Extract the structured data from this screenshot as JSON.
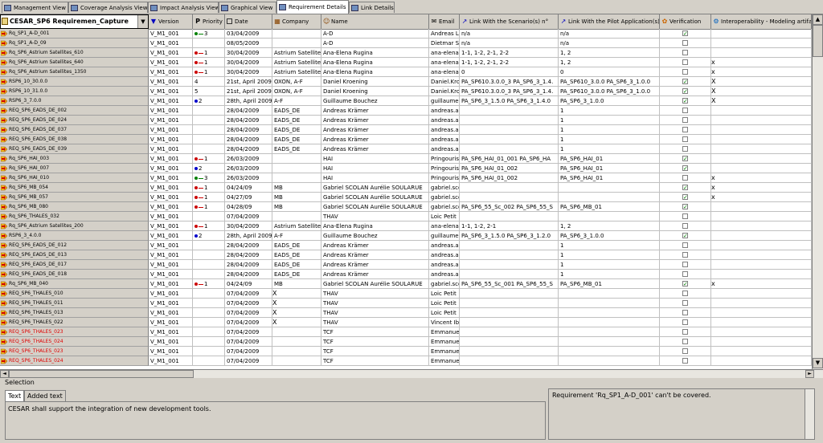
{
  "tabs": [
    {
      "label": "Management View",
      "active": false
    },
    {
      "label": "Coverage Analysis View",
      "active": false
    },
    {
      "label": "Impact Analysis View",
      "active": false
    },
    {
      "label": "Graphical View",
      "active": false
    },
    {
      "label": "Requirement Details",
      "active": true
    },
    {
      "label": "Link Details",
      "active": false
    }
  ],
  "selector": {
    "value": "CESAR_SP6   Requiremen_Capture"
  },
  "columns": [
    "Version",
    "Priority",
    "Date",
    "Company",
    "Name",
    "Email",
    "Link With the Scenario(s) n°",
    "Link With the Pilot Application(s) n°",
    "Verification",
    "Interoperability - Modeling artifact"
  ],
  "rows": [
    {
      "id": "Rq_SP1_A-D_001",
      "red": false,
      "version": "V_M1_001",
      "pcolor": "#008000",
      "pnum": "3",
      "date": "03/04/2009",
      "company": "",
      "name": "A-D",
      "email": "Andreas Len",
      "scen": "n/a",
      "pilot": "n/a",
      "ver": true,
      "interop": ""
    },
    {
      "id": "Rq_SP1_A-D_09",
      "red": false,
      "version": "V_M1_001",
      "pcolor": "",
      "pnum": "",
      "date": "08/05/2009",
      "company": "",
      "name": "A-D",
      "email": "Dietmar Sa",
      "scen": "n/a",
      "pilot": "n/a",
      "ver": false,
      "interop": ""
    },
    {
      "id": "Rq_SP6_Astrium Satellites_610",
      "red": false,
      "version": "V_M1_001",
      "pcolor": "#cc0000",
      "pnum": "1",
      "date": "30/04/2009",
      "company": "Astrium Satellites",
      "name": "Ana-Elena Rugina",
      "email": "ana-elena.r",
      "scen": "1-1, 1-2, 2-1, 2-2",
      "pilot": "1, 2",
      "ver": false,
      "interop": ""
    },
    {
      "id": "Rq_SP6_Astrium Satellites_640",
      "red": false,
      "version": "V_M1_001",
      "pcolor": "#cc0000",
      "pnum": "1",
      "date": "30/04/2009",
      "company": "Astrium Satellites",
      "name": "Ana-Elena Rugina",
      "email": "ana-elena.r",
      "scen": "1-1, 1-2, 2-1, 2-2",
      "pilot": "1, 2",
      "ver": false,
      "interop": "x"
    },
    {
      "id": "Rq_SP6_Astrium Satellites_1350",
      "red": false,
      "version": "V_M1_001",
      "pcolor": "#cc0000",
      "pnum": "1",
      "date": "30/04/2009",
      "company": "Astrium Satellites",
      "name": "Ana-Elena Rugina",
      "email": "ana-elena.r",
      "scen": "0",
      "pilot": "0",
      "ver": false,
      "interop": "x"
    },
    {
      "id": "RSP6_10_30.0.0",
      "red": false,
      "version": "V_M1_001",
      "pcolor": "",
      "pnum": "4",
      "date": "21st, April 2009",
      "company": "OXON, A-F",
      "name": "Daniel Kroening",
      "email": "Daniel.Kroe",
      "scen": "PA_SP610.3.0.0_3 PA_SP6_3_1.4.",
      "pilot": "PA_SP610_3.0.0 PA_SP6_3_1.0.0",
      "ver": true,
      "interop": "X"
    },
    {
      "id": "RSP6_10_31.0.0",
      "red": false,
      "version": "V_M1_001",
      "pcolor": "",
      "pnum": "5",
      "date": "21st, April 2009",
      "company": "OXON, A-F",
      "name": "Daniel Kroening",
      "email": "Daniel.Kroe",
      "scen": "PA_SP610.3.0.0_3 PA_SP6_3_1.4.",
      "pilot": "PA_SP610_3.0.0 PA_SP6_3_1.0.0",
      "ver": true,
      "interop": "X"
    },
    {
      "id": "RSP6_3_7.0.0",
      "red": false,
      "version": "V_M1_001",
      "pcolor": "#0000cc",
      "pnum": "2",
      "date": "28th, April 2009",
      "company": "A-F",
      "name": "Guillaume Bouchez",
      "email": "guillaume.b",
      "scen": "PA_SP6_3_1.5.0 PA_SP6_3_1.4.0",
      "pilot": "PA_SP6_3_1.0.0",
      "ver": true,
      "interop": "X"
    },
    {
      "id": "REQ_SP6_EADS_DE_002",
      "red": false,
      "version": "V_M1_001",
      "pcolor": "",
      "pnum": "",
      "date": "28/04/2009",
      "company": "EADS_DE",
      "name": "Andreas Krämer",
      "email": "andreas.a.k",
      "scen": "",
      "pilot": "1",
      "ver": false,
      "interop": ""
    },
    {
      "id": "REQ_SP6_EADS_DE_024",
      "red": false,
      "version": "V_M1_001",
      "pcolor": "",
      "pnum": "",
      "date": "28/04/2009",
      "company": "EADS_DE",
      "name": "Andreas Krämer",
      "email": "andreas.a.k",
      "scen": "",
      "pilot": "1",
      "ver": false,
      "interop": ""
    },
    {
      "id": "REQ_SP6_EADS_DE_037",
      "red": false,
      "version": "V_M1_001",
      "pcolor": "",
      "pnum": "",
      "date": "28/04/2009",
      "company": "EADS_DE",
      "name": "Andreas Krämer",
      "email": "andreas.a.k",
      "scen": "",
      "pilot": "1",
      "ver": false,
      "interop": ""
    },
    {
      "id": "REQ_SP6_EADS_DE_038",
      "red": false,
      "version": "V_M1_001",
      "pcolor": "",
      "pnum": "",
      "date": "28/04/2009",
      "company": "EADS_DE",
      "name": "Andreas Krämer",
      "email": "andreas.a.k",
      "scen": "",
      "pilot": "1",
      "ver": false,
      "interop": ""
    },
    {
      "id": "REQ_SP6_EADS_DE_039",
      "red": false,
      "version": "V_M1_001",
      "pcolor": "",
      "pnum": "",
      "date": "28/04/2009",
      "company": "EADS_DE",
      "name": "Andreas Krämer",
      "email": "andreas.a.k",
      "scen": "",
      "pilot": "1",
      "ver": false,
      "interop": ""
    },
    {
      "id": "Rq_SP6_HAI_003",
      "red": false,
      "version": "V_M1_001",
      "pcolor": "#cc0000",
      "pnum": "1",
      "date": "26/03/2009",
      "company": "",
      "name": "HAI",
      "email": "Pringouris",
      "scen": "PA_SP6_HAI_01_001 PA_SP6_HA",
      "pilot": "PA_SP6_HAI_01",
      "ver": true,
      "interop": ""
    },
    {
      "id": "Rq_SP6_HAI_007",
      "red": false,
      "version": "V_M1_001",
      "pcolor": "#0000cc",
      "pnum": "2",
      "date": "26/03/2009",
      "company": "",
      "name": "HAI",
      "email": "Pringouris",
      "scen": "PA_SP6_HAI_01_002",
      "pilot": "PA_SP6_HAI_01",
      "ver": true,
      "interop": ""
    },
    {
      "id": "Rq_SP6_HAI_010",
      "red": false,
      "version": "V_M1_001",
      "pcolor": "#008000",
      "pnum": "3",
      "date": "26/03/2009",
      "company": "",
      "name": "HAI",
      "email": "Pringouris",
      "scen": "PA_SP6_HAI_01_002",
      "pilot": "PA_SP6_HAI_01",
      "ver": false,
      "interop": "x"
    },
    {
      "id": "Rq_SP6_MB_054",
      "red": false,
      "version": "V_M1_001",
      "pcolor": "#cc0000",
      "pnum": "1",
      "date": "04/24/09",
      "company": "MB",
      "name": "Gabriel SCOLAN Aurélie SOULARUE",
      "email": "gabriel.scol",
      "scen": "",
      "pilot": "",
      "ver": true,
      "interop": "x"
    },
    {
      "id": "Rq_SP6_MB_057",
      "red": false,
      "version": "V_M1_001",
      "pcolor": "#cc0000",
      "pnum": "1",
      "date": "04/27/09",
      "company": "MB",
      "name": "Gabriel SCOLAN Aurélie SOULARUE",
      "email": "gabriel.scol",
      "scen": "",
      "pilot": "",
      "ver": true,
      "interop": "x"
    },
    {
      "id": "Rq_SP6_MB_080",
      "red": false,
      "version": "V_M1_001",
      "pcolor": "#cc0000",
      "pnum": "1",
      "date": "04/28/09",
      "company": "MB",
      "name": "Gabriel SCOLAN Aurélie SOULARUE",
      "email": "gabriel.scol",
      "scen": "PA_SP6_55_Sc_002 PA_SP6_55_S",
      "pilot": "PA_SP6_MB_01",
      "ver": true,
      "interop": ""
    },
    {
      "id": "Rq_SP6_THALES_032",
      "red": false,
      "version": "V_M1_001",
      "pcolor": "",
      "pnum": "",
      "date": "07/04/2009",
      "company": "",
      "name": "THAV",
      "email": "Loic Petit",
      "scen": "",
      "pilot": "",
      "ver": false,
      "interop": ""
    },
    {
      "id": "Rq_SP6_Astrium Satellites_200",
      "red": false,
      "version": "V_M1_001",
      "pcolor": "#cc0000",
      "pnum": "1",
      "date": "30/04/2009",
      "company": "Astrium Satellites",
      "name": "Ana-Elena Rugina",
      "email": "ana-elena.r",
      "scen": "1-1, 1-2, 2-1",
      "pilot": "1, 2",
      "ver": false,
      "interop": ""
    },
    {
      "id": "RSP6_3_4.0.0",
      "red": false,
      "version": "V_M1_001",
      "pcolor": "#0000cc",
      "pnum": "2",
      "date": "28th, April 2009",
      "company": "A-F",
      "name": "Guillaume Bouchez",
      "email": "guillaume.b",
      "scen": "PA_SP6_3_1.5.0 PA_SP6_3_1.2.0",
      "pilot": "PA_SP6_3_1.0.0",
      "ver": true,
      "interop": ""
    },
    {
      "id": "REQ_SP6_EADS_DE_012",
      "red": false,
      "version": "V_M1_001",
      "pcolor": "",
      "pnum": "",
      "date": "28/04/2009",
      "company": "EADS_DE",
      "name": "Andreas Krämer",
      "email": "andreas.a.k",
      "scen": "",
      "pilot": "1",
      "ver": false,
      "interop": ""
    },
    {
      "id": "REQ_SP6_EADS_DE_013",
      "red": false,
      "version": "V_M1_001",
      "pcolor": "",
      "pnum": "",
      "date": "28/04/2009",
      "company": "EADS_DE",
      "name": "Andreas Krämer",
      "email": "andreas.a.k",
      "scen": "",
      "pilot": "1",
      "ver": false,
      "interop": ""
    },
    {
      "id": "REQ_SP6_EADS_DE_017",
      "red": false,
      "version": "V_M1_001",
      "pcolor": "",
      "pnum": "",
      "date": "28/04/2009",
      "company": "EADS_DE",
      "name": "Andreas Krämer",
      "email": "andreas.a.k",
      "scen": "",
      "pilot": "1",
      "ver": false,
      "interop": ""
    },
    {
      "id": "REQ_SP6_EADS_DE_018",
      "red": false,
      "version": "V_M1_001",
      "pcolor": "",
      "pnum": "",
      "date": "28/04/2009",
      "company": "EADS_DE",
      "name": "Andreas Krämer",
      "email": "andreas.a.k",
      "scen": "",
      "pilot": "1",
      "ver": false,
      "interop": ""
    },
    {
      "id": "Rq_SP6_MB_040",
      "red": false,
      "version": "V_M1_001",
      "pcolor": "#cc0000",
      "pnum": "1",
      "date": "04/24/09",
      "company": "MB",
      "name": "Gabriel SCOLAN Aurélie SOULARUE",
      "email": "gabriel.scol",
      "scen": "PA_SP6_55_Sc_001 PA_SP6_55_S",
      "pilot": "PA_SP6_MB_01",
      "ver": true,
      "interop": "x"
    },
    {
      "id": "REQ_SP6_THALES_010",
      "red": false,
      "version": "V_M1_001",
      "pcolor": "",
      "pnum": "",
      "date": "07/04/2009",
      "company": "X",
      "name": "THAV",
      "email": "Loic Petit",
      "scen": "",
      "pilot": "",
      "ver": false,
      "interop": ""
    },
    {
      "id": "REQ_SP6_THALES_011",
      "red": false,
      "version": "V_M1_001",
      "pcolor": "",
      "pnum": "",
      "date": "07/04/2009",
      "company": "X",
      "name": "THAV",
      "email": "Loic Petit",
      "scen": "",
      "pilot": "",
      "ver": false,
      "interop": ""
    },
    {
      "id": "REQ_SP6_THALES_013",
      "red": false,
      "version": "V_M1_001",
      "pcolor": "",
      "pnum": "",
      "date": "07/04/2009",
      "company": "X",
      "name": "THAV",
      "email": "Loic Petit",
      "scen": "",
      "pilot": "",
      "ver": false,
      "interop": ""
    },
    {
      "id": "REQ_SP6_THALES_022",
      "red": false,
      "version": "V_M1_001",
      "pcolor": "",
      "pnum": "",
      "date": "07/04/2009",
      "company": "X",
      "name": "THAV",
      "email": "Vincent Iba",
      "scen": "",
      "pilot": "",
      "ver": false,
      "interop": ""
    },
    {
      "id": "REQ_SP6_THALES_023",
      "red": true,
      "version": "V_M1_001",
      "pcolor": "",
      "pnum": "",
      "date": "07/04/2009",
      "company": "",
      "name": "TCF",
      "email": "Emmanuel",
      "scen": "",
      "pilot": "",
      "ver": false,
      "interop": ""
    },
    {
      "id": "REQ_SP6_THALES_024",
      "red": true,
      "version": "V_M1_001",
      "pcolor": "",
      "pnum": "",
      "date": "07/04/2009",
      "company": "",
      "name": "TCF",
      "email": "Emmanuel",
      "scen": "",
      "pilot": "",
      "ver": false,
      "interop": ""
    },
    {
      "id": "REQ_SP6_THALES_023",
      "red": true,
      "version": "V_M1_001",
      "pcolor": "",
      "pnum": "",
      "date": "07/04/2009",
      "company": "",
      "name": "TCF",
      "email": "Emmanuel",
      "scen": "",
      "pilot": "",
      "ver": false,
      "interop": ""
    },
    {
      "id": "REQ_SP6_THALES_024",
      "red": true,
      "version": "V_M1_001",
      "pcolor": "",
      "pnum": "",
      "date": "07/04/2009",
      "company": "",
      "name": "TCF",
      "email": "Emmanuel",
      "scen": "",
      "pilot": "",
      "ver": false,
      "interop": ""
    }
  ],
  "selection": {
    "label": "Selection",
    "tabs": [
      "Text",
      "Added text"
    ],
    "text": "CESAR shall support the integration of new development tools."
  },
  "message": "Requirement 'Rq_SP1_A-D_001' can't be covered.",
  "colors": {
    "priority_high": "#cc0000",
    "priority_medium": "#0000cc",
    "priority_low": "#008000",
    "check": "#008000",
    "red_row": "#e00000"
  }
}
